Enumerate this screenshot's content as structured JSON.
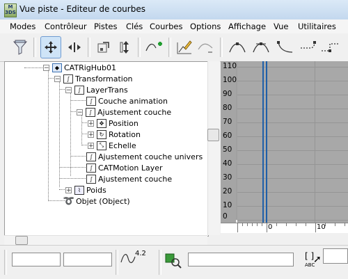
{
  "window": {
    "title": "Vue piste - Editeur de courbes",
    "app_icon_text": "M\n3DS"
  },
  "menu": [
    "Modes",
    "Contrôleur",
    "Pistes",
    "Clés",
    "Courbes",
    "Options",
    "Affichage",
    "Vue",
    "Utilitaires"
  ],
  "toolbar": {
    "icons": [
      "filter-icon",
      "move-keys-icon",
      "slide-keys-icon",
      "scale-keys-icon",
      "scale-values-icon",
      "add-keys-icon",
      "draw-curves-icon",
      "reduce-keys-icon",
      "auto-tangent-icon",
      "custom-tangent-icon",
      "fast-tangent-icon",
      "slow-tangent-icon",
      "step-tangent-icon"
    ]
  },
  "tree": {
    "rows": [
      {
        "label": "CATRigHub01",
        "expander": "−"
      },
      {
        "label": "Transformation",
        "expander": "−"
      },
      {
        "label": "LayerTrans",
        "expander": "−"
      },
      {
        "label": "Couche animation",
        "expander": ""
      },
      {
        "label": "Ajustement couche",
        "expander": "−"
      },
      {
        "label": "Position",
        "expander": "+"
      },
      {
        "label": "Rotation",
        "expander": "+"
      },
      {
        "label": "Echelle",
        "expander": "+"
      },
      {
        "label": "Ajustement couche univers",
        "expander": ""
      },
      {
        "label": "CATMotion Layer",
        "expander": ""
      },
      {
        "label": "Ajustement couche",
        "expander": ""
      },
      {
        "label": "Poids",
        "expander": "+"
      },
      {
        "label": "Objet (Object)",
        "expander": ""
      }
    ]
  },
  "curve": {
    "y_labels": [
      "110",
      "100",
      "90",
      "80",
      "70",
      "60",
      "50",
      "40",
      "30",
      "20",
      "10",
      "0"
    ],
    "timeline_labels": [
      "0",
      "10"
    ],
    "frame_color": "#1f5fa8"
  },
  "status": {
    "version_label": "4.2",
    "field1": "",
    "field2": "",
    "field3": "",
    "abc_label": "ABC"
  }
}
